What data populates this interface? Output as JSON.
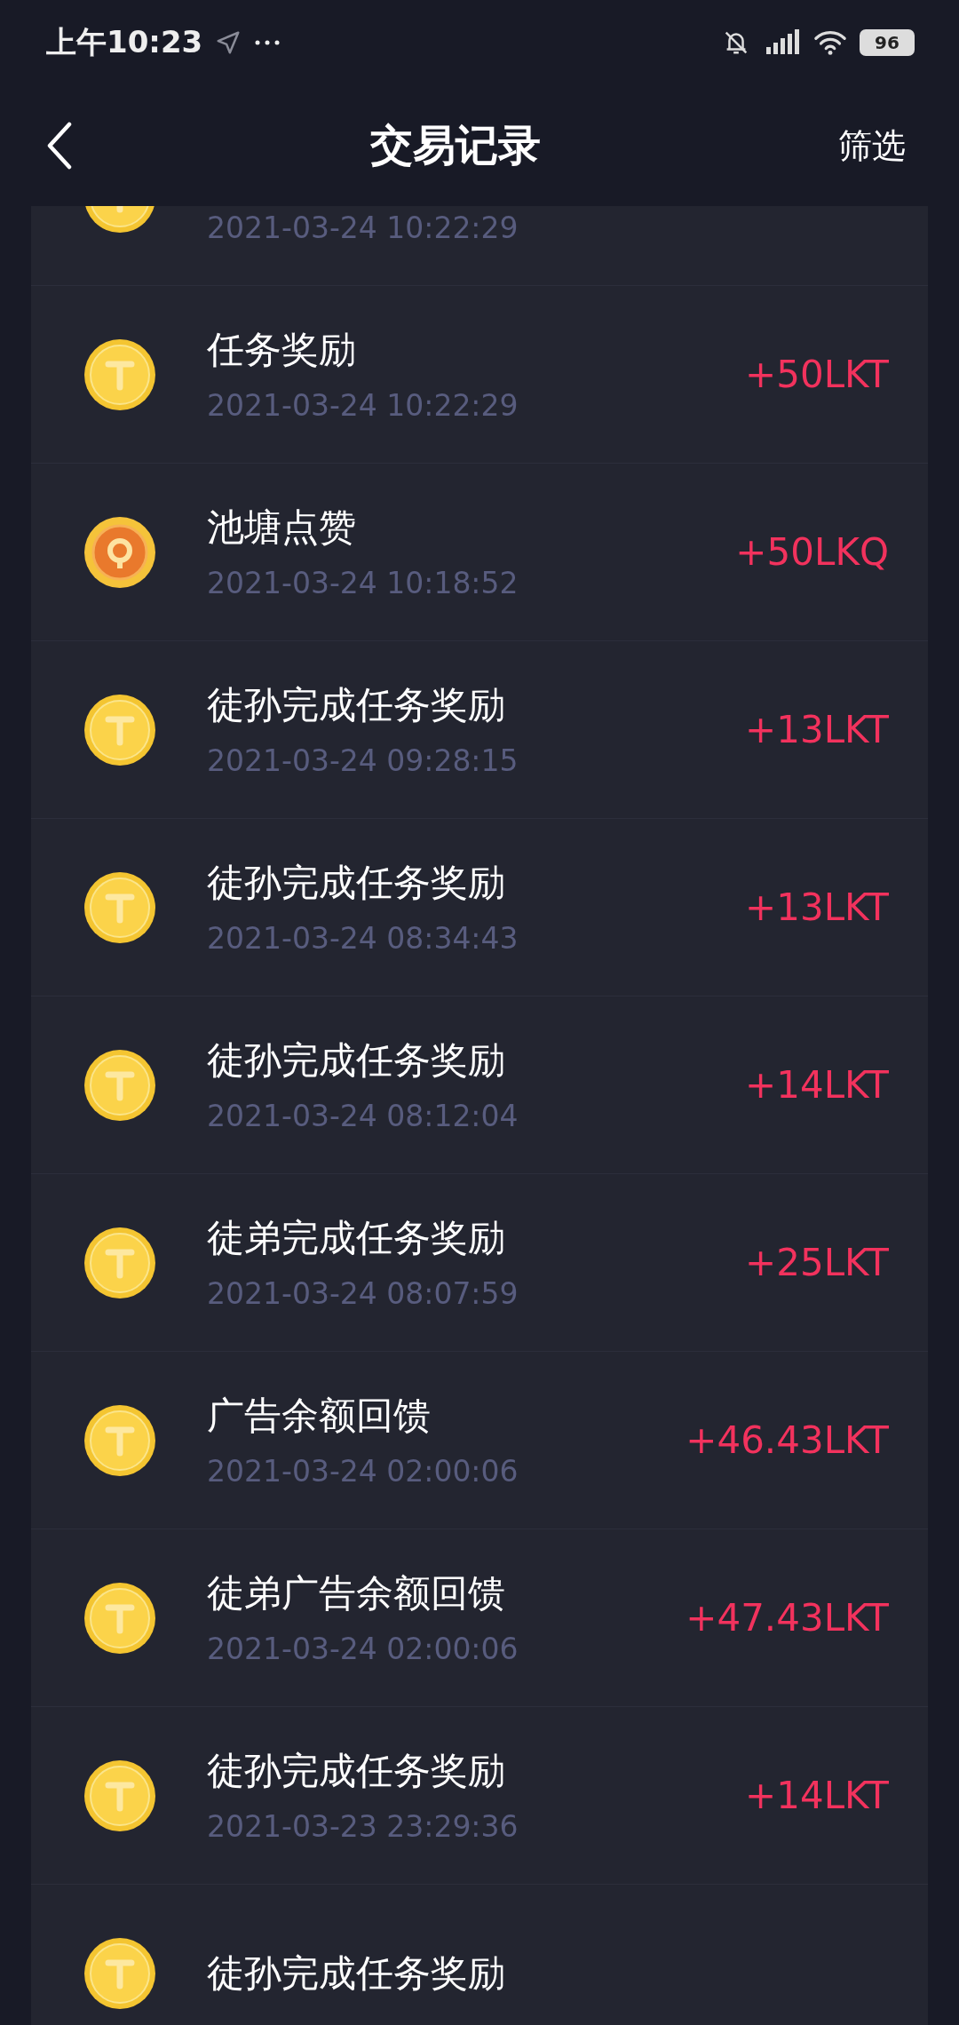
{
  "status_bar": {
    "time": "上午10:23",
    "battery": "96"
  },
  "header": {
    "title": "交易记录",
    "filter": "筛选"
  },
  "records": [
    {
      "kind": "t",
      "date": "2021-03-24 10:22:29"
    },
    {
      "kind": "t",
      "title": "任务奖励",
      "date": "2021-03-24 10:22:29",
      "amount": "+50LKT"
    },
    {
      "kind": "q",
      "title": "池塘点赞",
      "date": "2021-03-24 10:18:52",
      "amount": "+50LKQ"
    },
    {
      "kind": "t",
      "title": "徒孙完成任务奖励",
      "date": "2021-03-24 09:28:15",
      "amount": "+13LKT"
    },
    {
      "kind": "t",
      "title": "徒孙完成任务奖励",
      "date": "2021-03-24 08:34:43",
      "amount": "+13LKT"
    },
    {
      "kind": "t",
      "title": "徒孙完成任务奖励",
      "date": "2021-03-24 08:12:04",
      "amount": "+14LKT"
    },
    {
      "kind": "t",
      "title": "徒弟完成任务奖励",
      "date": "2021-03-24 08:07:59",
      "amount": "+25LKT"
    },
    {
      "kind": "t",
      "title": "广告余额回馈",
      "date": "2021-03-24 02:00:06",
      "amount": "+46.43LKT"
    },
    {
      "kind": "t",
      "title": "徒弟广告余额回馈",
      "date": "2021-03-24 02:00:06",
      "amount": "+47.43LKT"
    },
    {
      "kind": "t",
      "title": "徒孙完成任务奖励",
      "date": "2021-03-23 23:29:36",
      "amount": "+14LKT"
    },
    {
      "kind": "t",
      "title": "徒孙完成任务奖励"
    }
  ]
}
